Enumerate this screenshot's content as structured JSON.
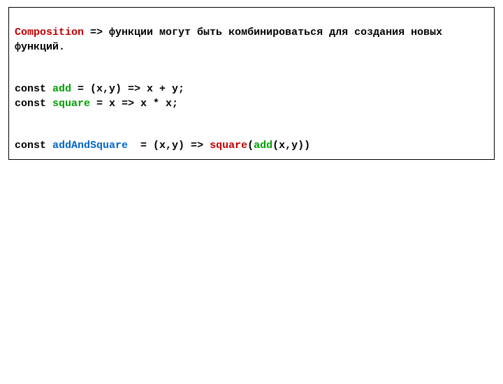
{
  "code": {
    "line1": {
      "composition": "Composition",
      "rest": " => функции могут быть комбинироваться для создания новых функций."
    },
    "line3": {
      "const": "const ",
      "add": "add",
      "rest": " = (x,y) => x + y;"
    },
    "line4": {
      "const": "const ",
      "square": "square",
      "rest": " = x => x * x;"
    },
    "line6": {
      "const": "const ",
      "addAndSquare": "addAndSquare",
      "eq": "  = (x,y) => ",
      "squareCall": "square",
      "open": "(",
      "addCall": "add",
      "close": "(x,y))"
    }
  }
}
